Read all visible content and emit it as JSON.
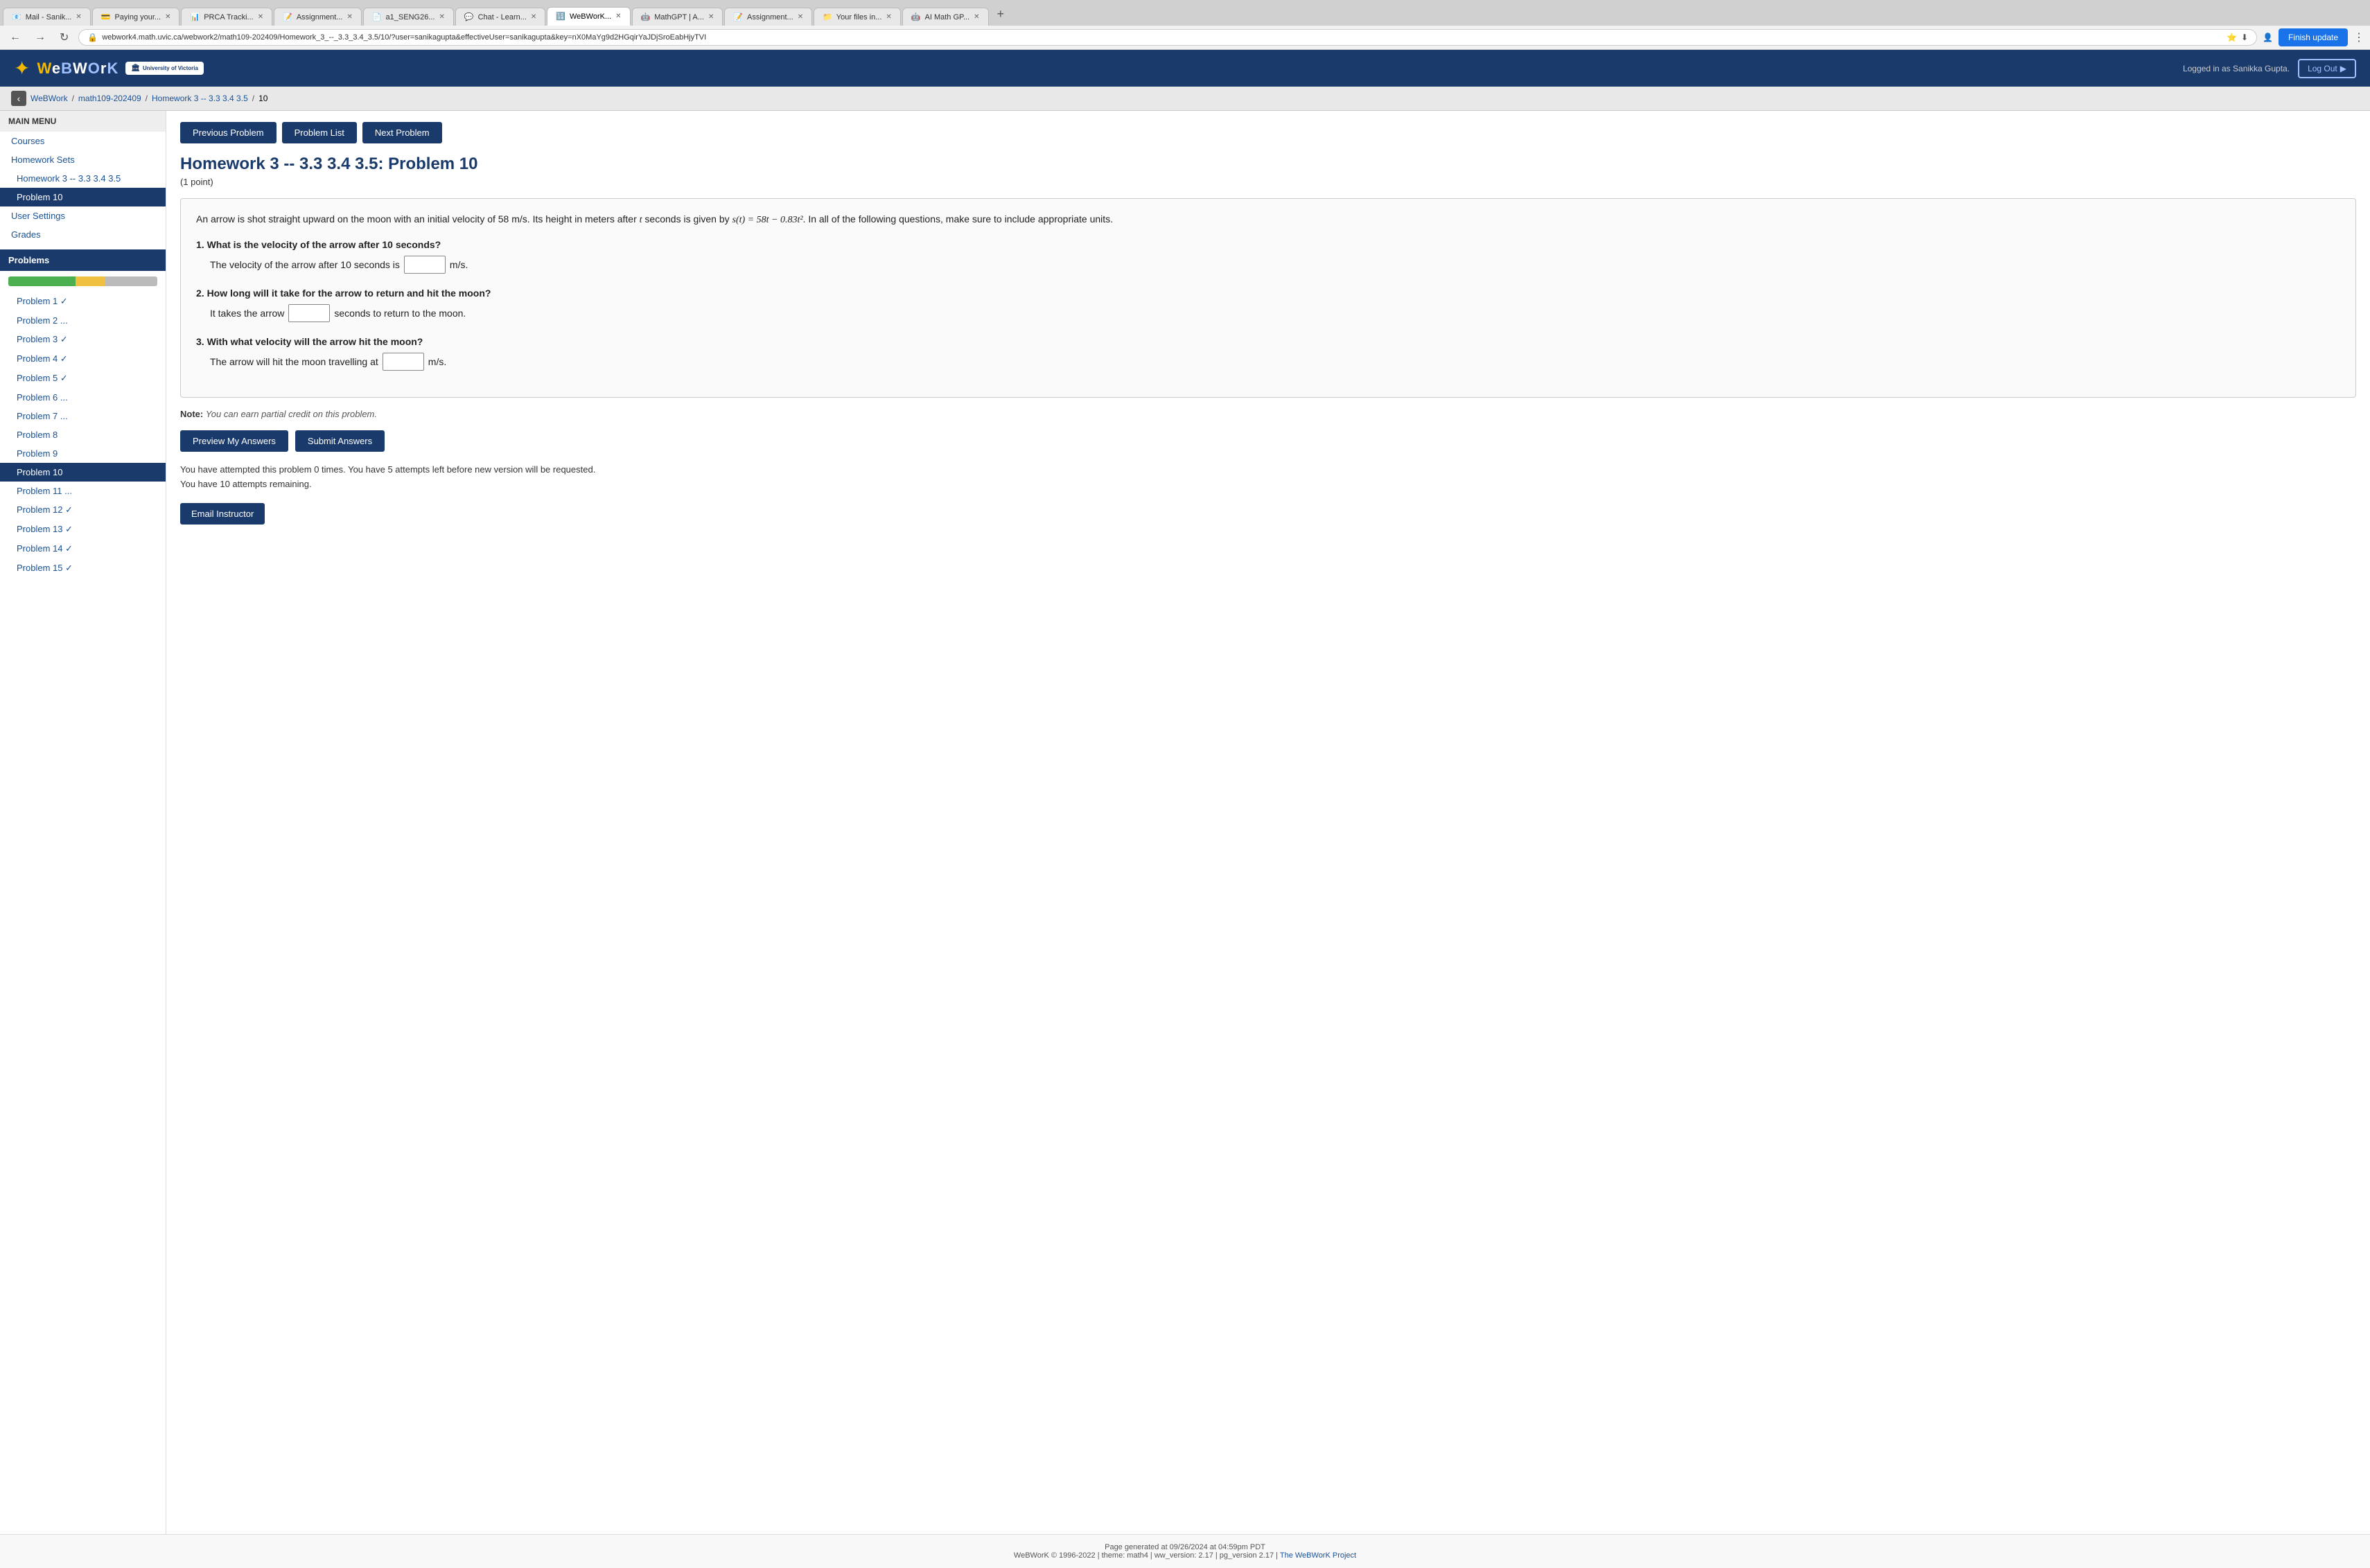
{
  "browser": {
    "address": "webwork4.math.uvic.ca/webwork2/math109-202409/Homework_3_--_3.3_3.4_3.5/10/?user=sanikagupta&effectiveUser=sanikagupta&key=nX0MaYg9d2HGqirYaJDjSroEabHjyTVI",
    "finish_update": "Finish update",
    "tabs": [
      {
        "label": "Mail - Sanik...",
        "favicon": "📧",
        "active": false
      },
      {
        "label": "Paying your...",
        "favicon": "💳",
        "active": false
      },
      {
        "label": "PRCA Tracki...",
        "favicon": "📊",
        "active": false
      },
      {
        "label": "Assignment...",
        "favicon": "📝",
        "active": false
      },
      {
        "label": "a1_SENG26...",
        "favicon": "📄",
        "active": false
      },
      {
        "label": "Chat - Learn...",
        "favicon": "💬",
        "active": false
      },
      {
        "label": "WeBWorK...",
        "favicon": "🔢",
        "active": true
      },
      {
        "label": "MathGPT | A...",
        "favicon": "🤖",
        "active": false
      },
      {
        "label": "Assignment...",
        "favicon": "📝",
        "active": false
      },
      {
        "label": "Your files in...",
        "favicon": "📁",
        "active": false
      },
      {
        "label": "AI Math GP...",
        "favicon": "🤖",
        "active": false
      }
    ]
  },
  "header": {
    "logo_text": "WeBWorK",
    "logo_w": "W",
    "university": "University of Victoria",
    "logged_in_text": "Logged in as Sanikka Gupta.",
    "logout_label": "Log Out"
  },
  "breadcrumb": {
    "back_title": "Back",
    "items": [
      "WeBWork",
      "math109-202409",
      "Homework 3 -- 3.3 3.4 3.5",
      "10"
    ],
    "separators": [
      "/",
      "/",
      "/"
    ]
  },
  "sidebar": {
    "main_menu_title": "MAIN MENU",
    "courses_link": "Courses",
    "homework_sets_link": "Homework Sets",
    "current_homework": "Homework 3 -- 3.3 3.4 3.5",
    "current_problem": "Problem 10",
    "user_settings_link": "User Settings",
    "grades_link": "Grades",
    "problems_title": "Problems",
    "problems": [
      {
        "label": "Problem 1 ✓",
        "active": false
      },
      {
        "label": "Problem 2 ...",
        "active": false
      },
      {
        "label": "Problem 3 ✓",
        "active": false
      },
      {
        "label": "Problem 4 ✓",
        "active": false
      },
      {
        "label": "Problem 5 ✓",
        "active": false
      },
      {
        "label": "Problem 6 ...",
        "active": false
      },
      {
        "label": "Problem 7 ...",
        "active": false
      },
      {
        "label": "Problem 8",
        "active": false
      },
      {
        "label": "Problem 9",
        "active": false
      },
      {
        "label": "Problem 10",
        "active": true
      },
      {
        "label": "Problem 11 ...",
        "active": false
      },
      {
        "label": "Problem 12 ✓",
        "active": false
      },
      {
        "label": "Problem 13 ✓",
        "active": false
      },
      {
        "label": "Problem 14 ✓",
        "active": false
      },
      {
        "label": "Problem 15 ✓",
        "active": false
      }
    ]
  },
  "problem_nav": {
    "previous_label": "Previous Problem",
    "list_label": "Problem List",
    "next_label": "Next Problem"
  },
  "problem": {
    "title": "Homework 3 -- 3.3 3.4 3.5: Problem 10",
    "points": "(1 point)",
    "intro": "An arrow is shot straight upward on the moon with an initial velocity of 58 m/s. Its height in meters after t seconds is given by s(t) = 58t − 0.83t². In all of the following questions, make sure to include appropriate units.",
    "q1_text": "1. What is the velocity of the arrow after 10 seconds?",
    "q1_answer_prefix": "The velocity of the arrow after 10 seconds is",
    "q1_answer_suffix": "m/s.",
    "q1_input_value": "",
    "q2_text": "2. How long will it take for the arrow to return and hit the moon?",
    "q2_answer_prefix": "It takes the arrow",
    "q2_answer_suffix": "seconds to return to the moon.",
    "q2_input_value": "",
    "q3_text": "3. With what velocity will the arrow hit the moon?",
    "q3_answer_prefix": "The arrow will hit the moon travelling at",
    "q3_answer_suffix": "m/s.",
    "q3_input_value": ""
  },
  "note": {
    "label": "Note:",
    "text": "You can earn partial credit on this problem."
  },
  "actions": {
    "preview_label": "Preview My Answers",
    "submit_label": "Submit Answers"
  },
  "attempt_info": {
    "line1": "You have attempted this problem 0 times. You have 5 attempts left before new version will be requested.",
    "line2": "You have 10 attempts remaining."
  },
  "email": {
    "label": "Email Instructor"
  },
  "footer": {
    "line1": "Page generated at 09/26/2024 at 04:59pm PDT",
    "line2": "WeBWorK © 1996-2022 | theme: math4 | ww_version: 2.17 | pg_version 2.17 | The WeBWorK Project"
  }
}
